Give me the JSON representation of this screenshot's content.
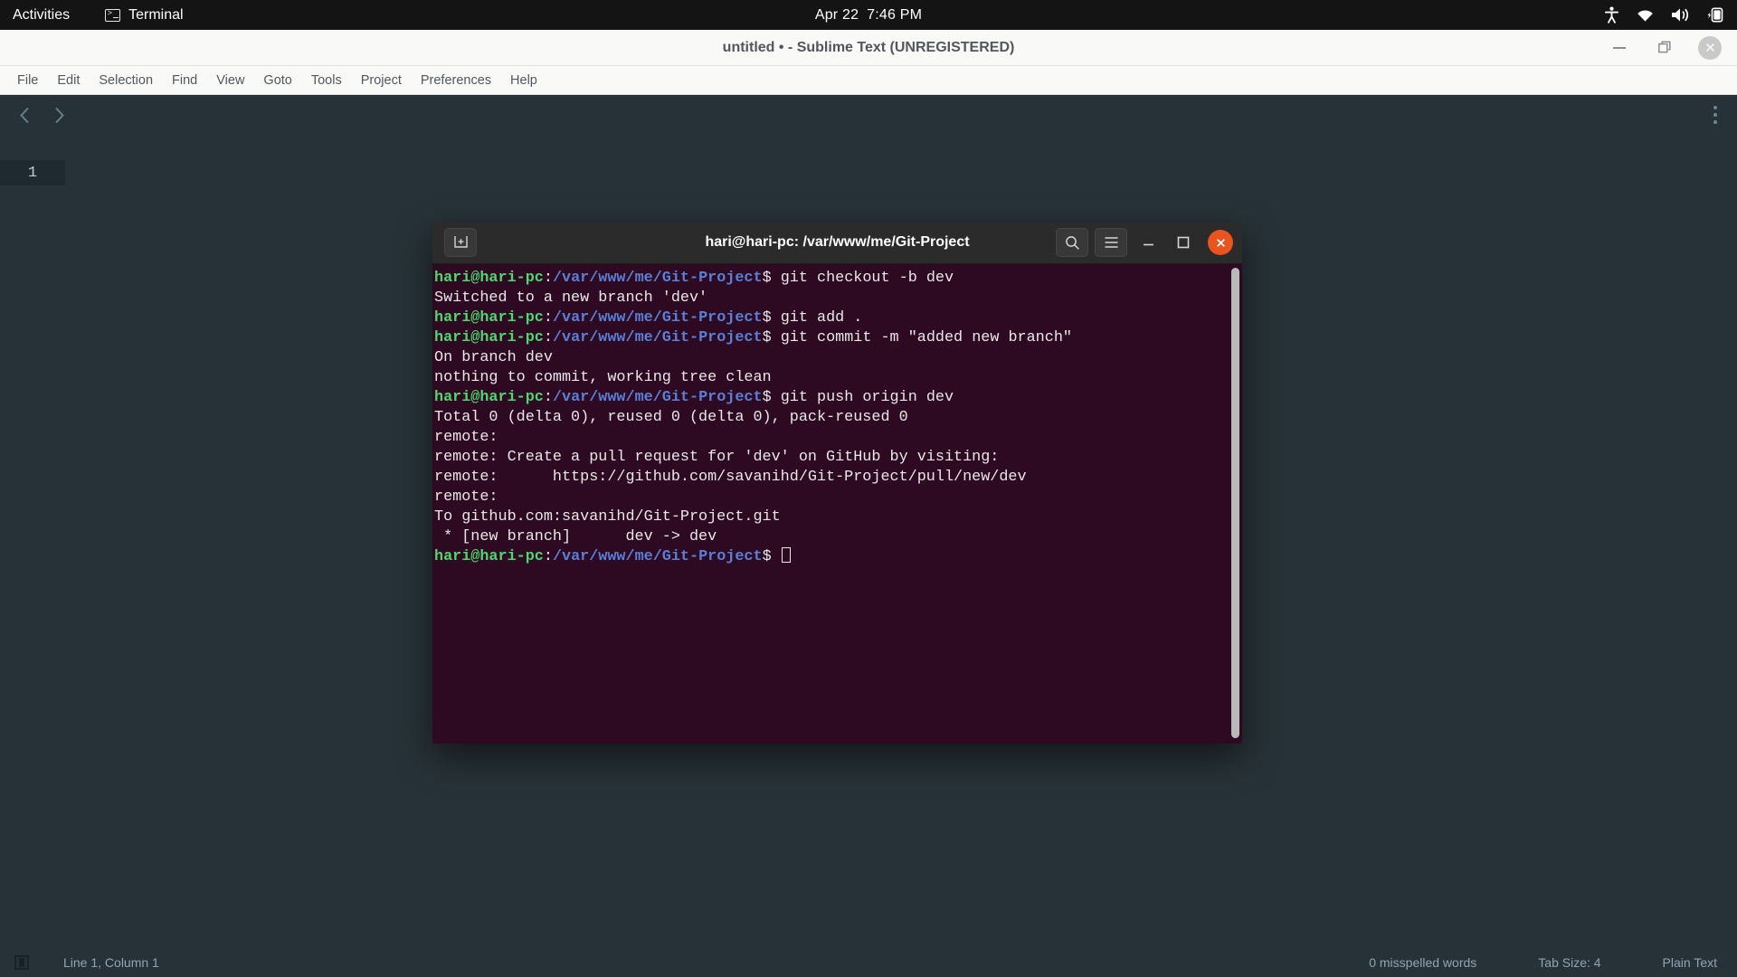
{
  "topbar": {
    "activities": "Activities",
    "app_name": "Terminal",
    "app_icon": "terminal-icon",
    "clock_date": "Apr 22",
    "clock_time": "7:46 PM",
    "tray": [
      {
        "name": "accessibility-icon"
      },
      {
        "name": "wifi-icon"
      },
      {
        "name": "volume-icon"
      },
      {
        "name": "battery-charging-icon"
      }
    ]
  },
  "sublime": {
    "title": "untitled • - Sublime Text (UNREGISTERED)",
    "window_buttons": {
      "minimize": "minimize-button",
      "maximize": "maximize-button",
      "close": "close-button"
    },
    "menu": [
      "File",
      "Edit",
      "Selection",
      "Find",
      "View",
      "Goto",
      "Tools",
      "Project",
      "Preferences",
      "Help"
    ],
    "toolbar": {
      "back": "back-arrow",
      "forward": "forward-arrow",
      "more": "more-options"
    },
    "gutter": {
      "line_number": "1"
    },
    "statusbar": {
      "line_column": "Line 1, Column 1",
      "spelling": "0 misspelled words",
      "tab_size": "Tab Size: 4",
      "syntax": "Plain Text"
    }
  },
  "terminal": {
    "title": "hari@hari-pc: /var/www/me/Git-Project",
    "buttons": {
      "new_tab": "new-tab-icon",
      "search": "search-icon",
      "menu": "hamburger-menu-icon",
      "minimize": "minimize-button",
      "maximize": "maximize-button",
      "close": "close-button"
    },
    "prompt": {
      "user": "hari@hari-pc",
      "separator": ":",
      "path": "/var/www/me/Git-Project",
      "symbol": "$"
    },
    "lines": [
      {
        "type": "prompt",
        "command": " git checkout -b dev"
      },
      {
        "type": "output",
        "text": "Switched to a new branch 'dev'"
      },
      {
        "type": "prompt",
        "command": " git add ."
      },
      {
        "type": "prompt",
        "command": " git commit -m \"added new branch\""
      },
      {
        "type": "output",
        "text": "On branch dev"
      },
      {
        "type": "output",
        "text": "nothing to commit, working tree clean"
      },
      {
        "type": "prompt",
        "command": " git push origin dev"
      },
      {
        "type": "output",
        "text": "Total 0 (delta 0), reused 0 (delta 0), pack-reused 0"
      },
      {
        "type": "output",
        "text": "remote: "
      },
      {
        "type": "output",
        "text": "remote: Create a pull request for 'dev' on GitHub by visiting:"
      },
      {
        "type": "output",
        "text": "remote:      https://github.com/savanihd/Git-Project/pull/new/dev"
      },
      {
        "type": "output",
        "text": "remote: "
      },
      {
        "type": "output",
        "text": "To github.com:savanihd/Git-Project.git"
      },
      {
        "type": "output",
        "text": " * [new branch]      dev -> dev"
      },
      {
        "type": "prompt",
        "command": " ",
        "cursor": true
      }
    ]
  },
  "colors": {
    "topbar_bg": "#141414",
    "sublime_bg": "#273238",
    "sublime_titlebar_bg": "#f9f9f8",
    "terminal_bg": "#2d0a22",
    "terminal_titlebar_bg": "#2b2b2b",
    "terminal_close": "#e9541f",
    "prompt_user": "#4fd66f",
    "prompt_path": "#5a7fd6",
    "terminal_text": "#e8e8e8"
  }
}
